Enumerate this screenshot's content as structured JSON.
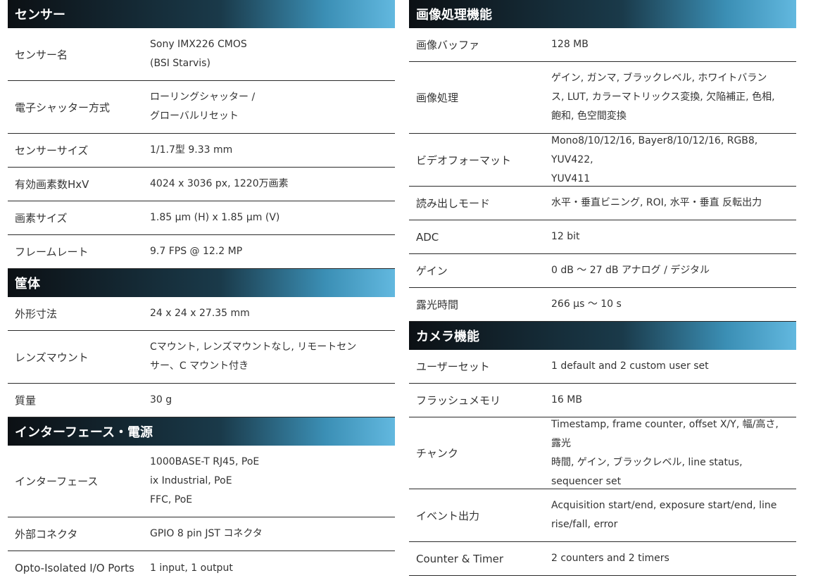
{
  "left": [
    {
      "title": "センサー",
      "rows": [
        {
          "label": "センサー名",
          "value": "Sony IMX226 CMOS\n(BSI Starvis)"
        },
        {
          "label": "電子シャッター方式",
          "value": "ローリングシャッター /\nグローバルリセット"
        },
        {
          "label": "センサーサイズ",
          "value": "1/1.7型 9.33 mm"
        },
        {
          "label": "有効画素数HxV",
          "value": "4024 x 3036 px, 1220万画素"
        },
        {
          "label": "画素サイズ",
          "value": "1.85 µm (H) x 1.85 µm (V)"
        },
        {
          "label": "フレームレート",
          "value": "9.7 FPS @ 12.2 MP"
        }
      ]
    },
    {
      "title": "筐体",
      "rows": [
        {
          "label": "外形寸法",
          "value": "24 x 24 x 27.35 mm"
        },
        {
          "label": "レンズマウント",
          "value": "Cマウント, レンズマウントなし, リモートセン\nサー、C マウント付き"
        },
        {
          "label": "質量",
          "value": "30 g"
        }
      ]
    },
    {
      "title": "インターフェース・電源",
      "rows": [
        {
          "label": "インターフェース",
          "value": "1000BASE-T RJ45, PoE\nix Industrial, PoE\nFFC, PoE"
        },
        {
          "label": "外部コネクタ",
          "value": "GPIO 8 pin JST コネクタ"
        },
        {
          "label": "Opto-Isolated I/O Ports",
          "value": "1 input, 1 output"
        }
      ]
    }
  ],
  "right": [
    {
      "title": "画像処理機能",
      "rows": [
        {
          "label": "画像バッファ",
          "value": "128 MB"
        },
        {
          "label": "画像処理",
          "value": "ゲイン, ガンマ, ブラックレベル, ホワイトバラン\nス, LUT, カラーマトリックス変換, 欠陥補正, 色相,\n飽和, 色空間変換"
        },
        {
          "label": "ビデオフォーマット",
          "value": "Mono8/10/12/16, Bayer8/10/12/16, RGB8, YUV422,\nYUV411"
        },
        {
          "label": "読み出しモード",
          "value": "水平・垂直ビニング, ROI, 水平・垂直 反転出力"
        },
        {
          "label": "ADC",
          "value": "12 bit"
        },
        {
          "label": "ゲイン",
          "value": "0 dB ～ 27 dB アナログ / デジタル"
        },
        {
          "label": "露光時間",
          "value": "266 µs ～ 10 s"
        }
      ]
    },
    {
      "title": "カメラ機能",
      "rows": [
        {
          "label": "ユーザーセット",
          "value": "1 default and 2 custom user set"
        },
        {
          "label": "フラッシュメモリ",
          "value": "16 MB"
        },
        {
          "label": "チャンク",
          "value": "Timestamp, frame counter, offset X/Y, 幅/高さ, 露光\n時間, ゲイン, ブラックレベル, line status,\nsequencer set"
        },
        {
          "label": "イベント出力",
          "value": "Acquisition start/end, exposure start/end, line\nrise/fall, error"
        },
        {
          "label": "Counter & Timer",
          "value": "2 counters and 2 timers"
        }
      ]
    }
  ]
}
